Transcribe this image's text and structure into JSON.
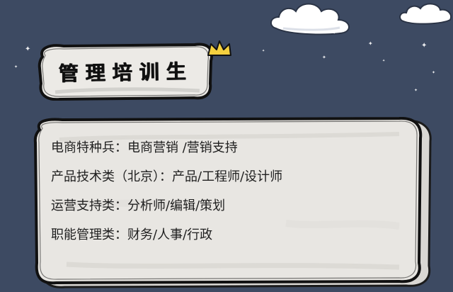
{
  "colors": {
    "background": "#3d4a62",
    "paper": "#e8e6e2",
    "ink": "#1f1f1f",
    "cloud": "#ffffff",
    "crown": "#f4d03f"
  },
  "title": "管理培训生",
  "icons": {
    "crown": "crown-icon",
    "clouds": "cloud-icon"
  },
  "lines": [
    "电商特种兵：电商营销  /营销支持",
    "产品技术类（北京）：产品/工程师/设计师",
    "运营支持类：分析师/编辑/策划",
    "职能管理类：财务/人事/行政"
  ]
}
